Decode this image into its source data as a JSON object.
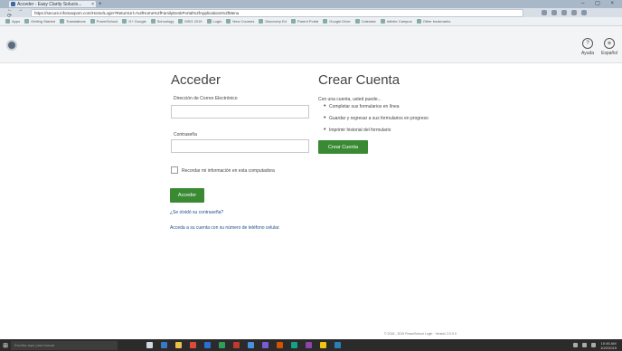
{
  "browser": {
    "tab_title": "Acceder - Easy Clarity Solucio...",
    "tab_close": "×",
    "new_tab": "+",
    "window_controls": "– ▢ ×",
    "nav_buttons": "← → ⟳",
    "url": "https://secure.infomaxpom.com/Home/Login?ReturnUrl=%2fHome%2fFamilyDeskPortal%2fApplications%2fMenu"
  },
  "bookmarks": [
    {
      "label": "Apps"
    },
    {
      "label": "Getting Started"
    },
    {
      "label": "Translations"
    },
    {
      "label": "PowerSchool"
    },
    {
      "label": "G+ Google"
    },
    {
      "label": "Schoology"
    },
    {
      "label": "MSG 2019"
    },
    {
      "label": "Login"
    },
    {
      "label": "New Courses"
    },
    {
      "label": "Discovery Ed"
    },
    {
      "label": "Parent Portal"
    },
    {
      "label": "Google Drive"
    },
    {
      "label": "Calendar"
    },
    {
      "label": "Infinite Campus"
    },
    {
      "label": "Other bookmarks"
    }
  ],
  "header": {
    "help_label": "Ayuda",
    "help_icon": "?",
    "language_label": "Español",
    "language_icon": "🌐"
  },
  "login": {
    "title": "Acceder",
    "email_label": "Dirección de Correo Electrónico",
    "email_value": "",
    "password_label": "Contraseña",
    "password_value": "",
    "remember_label": "Recordar mi información en esta computadora",
    "submit_label": "Acceder",
    "forgot_link": "¿Se olvidó su contraseña?",
    "phone_link": "Acceda a su cuenta con su número de teléfono celular."
  },
  "signup": {
    "title": "Crear Cuenta",
    "intro": "Con una cuenta, usted puede...",
    "benefits": [
      "Completar sus formularios en línea",
      "Guardar y regresar a sus formularios en progreso",
      "Imprimir historial del formulario"
    ],
    "button_label": "Crear Cuenta"
  },
  "footer": {
    "text": "© 2016 - 2019 PowerSchool Login · Versión 2.0.0.0"
  },
  "taskbar": {
    "search_placeholder": "Escriba aquí para buscar",
    "time": "10:45 AM",
    "date": "10/2/2019"
  },
  "colors": {
    "primary_button": "#3a8a34",
    "link": "#1d4e8a",
    "header_bg": "#f3f4f5"
  }
}
